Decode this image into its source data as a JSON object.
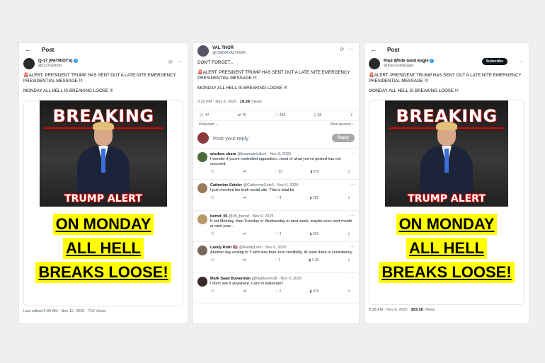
{
  "left_panel": {
    "topbar_title": "Post",
    "user": {
      "name": "Q-17 (PATRIOTS)",
      "handle": "@Q17patriots"
    },
    "post_text_1": "🚨ALERT: PRESIDENT TRUMP HAS SENT OUT A LATE NITE EMERGENCY PRESIDENTIAL MESSAGE !!!",
    "post_text_2": "MONDAY ALL HELL IS BREAKING LOOSE !!!",
    "image": {
      "breaking": "BREAKING",
      "trump_alert": "TRUMP ALERT",
      "line1": "ON MONDAY",
      "line2": "ALL HELL",
      "line3": "BREAKS LOOSE!"
    },
    "meta": "Last edited 9:35 AM · Nov 15, 2025 · 71K Views"
  },
  "middle_panel": {
    "user": {
      "name": "VAL THOR",
      "handle": "@CMDRVALTHOR"
    },
    "post_text_0": "DON'T FORGET...",
    "post_text_1": "🚨ALERT: PRESIDENT TRUMP HAS SENT OUT A LATE NITE EMERGENCY PRESIDENTIAL MESSAGE !!!",
    "post_text_2": "MONDAY ALL HELL IS BREAKING LOOSE !!!",
    "meta_time": "3:23 PM · Nov 9, 2025 ·",
    "meta_views": "19.3K",
    "meta_views_label": "Views",
    "stats": {
      "replies": "47",
      "reposts": "76",
      "likes": "436",
      "bookmarks": "28"
    },
    "relevant_label": "Relevant",
    "view_quotes_label": "View quotes",
    "reply_placeholder": "Post your reply",
    "reply_button": "Reply",
    "replies": [
      {
        "name": "wisdom share",
        "handle": "@traumaintuitive · Nov 9, 2025",
        "text": "I wonder if you're controlled opposition...most of what you've posted has not occurred.",
        "likes": "13",
        "views": "979"
      },
      {
        "name": "Catherine Setzler",
        "handle": "@CatherineSetz3 · Nov 9, 2025",
        "text": "I just checked his truth social site. This is total bs",
        "likes": "4",
        "views": "782"
      },
      {
        "name": "bernd_05",
        "handle": "@05_bernd · Nov 9, 2025",
        "text": "If not Monday, then Tuesday or Wednesday or next week, maybe even next month or next year...",
        "likes": "4",
        "views": "600"
      },
      {
        "name": "Landy Rohr 🇺🇸",
        "handle": "@RandyLohr · Nov 9, 2025",
        "text": "Another day ending in Y with less than zero credibility.  At least there is consistency.",
        "likes": "2",
        "views": "1.3K"
      },
      {
        "name": "Mark Saad Bowerman",
        "handle": "@Mableann38 · Nov 9, 2025",
        "text": "I don't see it anywhere.  Care to elaborate?",
        "likes": "2",
        "views": "376"
      }
    ]
  },
  "right_panel": {
    "topbar_title": "Post",
    "user": {
      "name": "Paul White Gold Eagle",
      "handle": "@PaulGoldEagle"
    },
    "subscribe_label": "Subscribe",
    "post_text_1": "🚨ALERT: PRESIDENT TRUMP HAS SENT OUT A LATE NITE EMERGENCY PRESIDENTIAL MESSAGE !!!",
    "post_text_2": "MONDAY ALL HELL IS BREAKING LOOSE !!!",
    "image": {
      "breaking": "BREAKING",
      "trump_alert": "TRUMP ALERT",
      "line1": "ON MONDAY",
      "line2": "ALL HELL",
      "line3": "BREAKS LOOSE!"
    },
    "meta_time": "9:28 AM · Nov 8, 2025 ·",
    "meta_views": "203.1K",
    "meta_views_label": "Views"
  }
}
